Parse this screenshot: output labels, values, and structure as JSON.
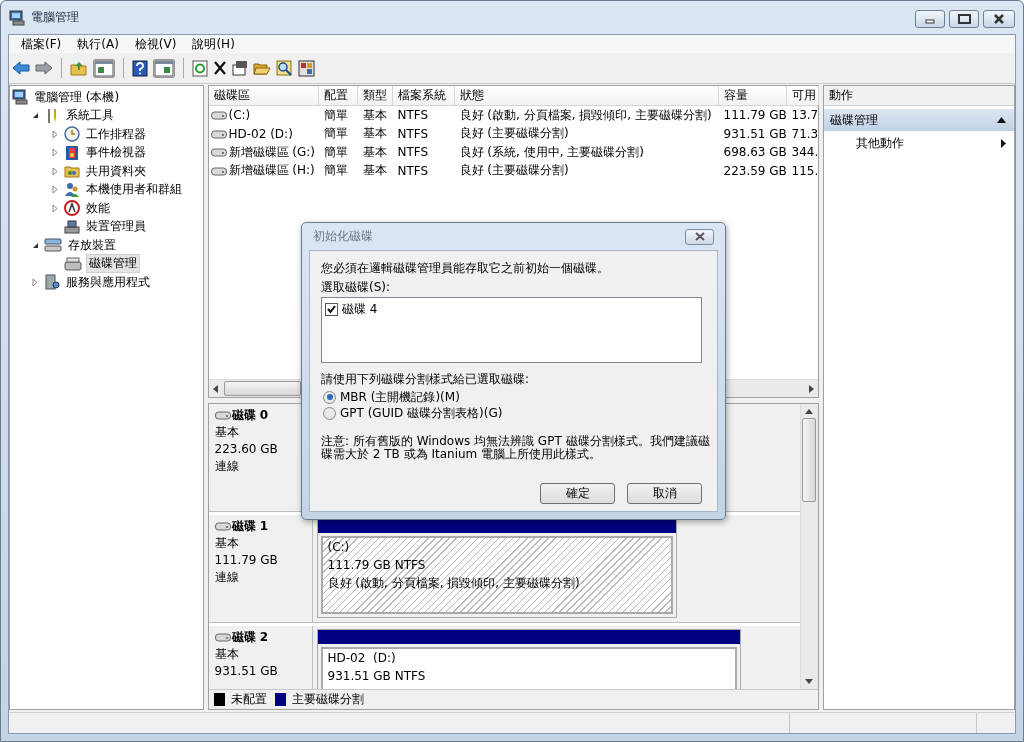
{
  "window": {
    "title": "電腦管理"
  },
  "menu": [
    "檔案(F)",
    "執行(A)",
    "檢視(V)",
    "說明(H)"
  ],
  "tree": [
    {
      "label": "電腦管理 (本機)",
      "selected": false,
      "children": [
        {
          "label": "系統工具",
          "expanded": true,
          "selected": false,
          "children": [
            {
              "label": "工作排程器",
              "expanded": false,
              "selected": false
            },
            {
              "label": "事件檢視器",
              "expanded": false,
              "selected": false
            },
            {
              "label": "共用資料夾",
              "expanded": false,
              "selected": false
            },
            {
              "label": "本機使用者和群組",
              "expanded": false,
              "selected": false
            },
            {
              "label": "效能",
              "expanded": false,
              "selected": false
            },
            {
              "label": "裝置管理員",
              "selected": false
            }
          ]
        },
        {
          "label": "存放裝置",
          "expanded": true,
          "selected": false,
          "children": [
            {
              "label": "磁碟管理",
              "selected": true
            }
          ]
        },
        {
          "label": "服務與應用程式",
          "expanded": false,
          "selected": false
        }
      ]
    }
  ],
  "volumes": {
    "columns": [
      "磁碟區",
      "配置",
      "類型",
      "檔案系統",
      "狀態",
      "容量",
      "可用"
    ],
    "rows": [
      [
        "(C:)",
        "簡單",
        "基本",
        "NTFS",
        "良好 (啟動, 分頁檔案, 損毀傾印, 主要磁碟分割)",
        "111.79 GB",
        "13.7"
      ],
      [
        "HD-02 (D:)",
        "簡單",
        "基本",
        "NTFS",
        "良好 (主要磁碟分割)",
        "931.51 GB",
        "71.3"
      ],
      [
        "新增磁碟區 (G:)",
        "簡單",
        "基本",
        "NTFS",
        "良好 (系統, 使用中, 主要磁碟分割)",
        "698.63 GB",
        "344."
      ],
      [
        "新增磁碟區 (H:)",
        "簡單",
        "基本",
        "NTFS",
        "良好 (主要磁碟分割)",
        "223.59 GB",
        "115."
      ]
    ]
  },
  "disks": [
    {
      "name": "磁碟 0",
      "type": "基本",
      "size": "223.60 GB",
      "status": "連線"
    },
    {
      "name": "磁碟 1",
      "type": "基本",
      "size": "111.79 GB",
      "status": "連線",
      "partitions": [
        {
          "name": "(C:)",
          "size": "111.79 GB NTFS",
          "status": "良好 (啟動, 分頁檔案, 損毀傾印, 主要磁碟分割)",
          "color": "#000080",
          "selected": true
        }
      ]
    },
    {
      "name": "磁碟 2",
      "type": "基本",
      "size": "931.51 GB",
      "partitions": [
        {
          "name": "HD-02  (D:)",
          "size": "931.51 GB NTFS",
          "color": "#000080",
          "selected": false
        }
      ]
    }
  ],
  "legend": [
    {
      "label": "未配置",
      "color": "#000000"
    },
    {
      "label": "主要磁碟分割",
      "color": "#000080"
    }
  ],
  "actions": {
    "title": "動作",
    "sections": [
      {
        "label": "磁碟管理",
        "expanded": true,
        "items": [
          "其他動作"
        ]
      }
    ]
  },
  "dialog": {
    "title": "初始化磁碟",
    "message": "您必須在邏輯磁碟管理員能存取它之前初始一個磁碟。",
    "list_label": "選取磁碟(S):",
    "disks": [
      {
        "label": "磁碟 4",
        "checked": true
      }
    ],
    "style_label": "請使用下列磁碟分割樣式給已選取磁碟:",
    "options": [
      {
        "label": "MBR (主開機記錄)(M)",
        "selected": true
      },
      {
        "label": "GPT (GUID 磁碟分割表格)(G)",
        "selected": false
      }
    ],
    "note": "注意: 所有舊版的 Windows 均無法辨識 GPT 磁碟分割樣式。我們建議磁碟需大於 2 TB 或為 Itanium 電腦上所使用此樣式。",
    "buttons": [
      "確定",
      "取消"
    ]
  }
}
